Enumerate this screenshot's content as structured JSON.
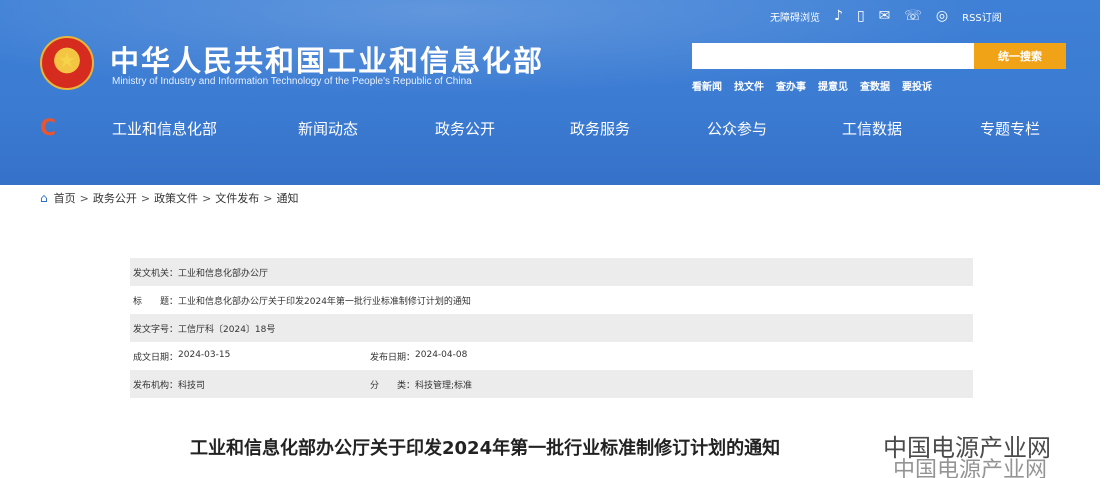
{
  "header": {
    "title": "中华人民共和国工业和信息化部",
    "subtitle": "Ministry of Industry and Information Technology of the People's Republic of China",
    "top_links": {
      "accessibility": "无障碍浏览",
      "rss": "RSS订阅"
    },
    "search": {
      "placeholder": "",
      "button_label": "统一搜索"
    },
    "quick_links": [
      "看新闻",
      "找文件",
      "查办事",
      "提意见",
      "查数据",
      "要投诉"
    ]
  },
  "nav": {
    "items": [
      "工业和信息化部",
      "新闻动态",
      "政务公开",
      "政务服务",
      "公众参与",
      "工信数据",
      "专题专栏"
    ]
  },
  "breadcrumb": [
    "首页",
    "政务公开",
    "政策文件",
    "文件发布",
    "通知"
  ],
  "meta": {
    "issuer_label": "发文机关：",
    "issuer": "工业和信息化部办公厅",
    "subject_label": "标　　题：",
    "subject": "工业和信息化部办公厅关于印发2024年第一批行业标准制修订计划的通知",
    "doc_no_label": "发文字号：",
    "doc_no": "工信厅科〔2024〕18号",
    "written_label": "成文日期：",
    "written": "2024-03-15",
    "published_label": "发布日期：",
    "published": "2024-04-08",
    "org_label": "发布机构：",
    "org": "科技司",
    "category_label": "分　　类：",
    "category": "科技管理;标准"
  },
  "document": {
    "title": "工业和信息化部办公厅关于印发2024年第一批行业标准制修订计划的通知"
  },
  "watermark": {
    "top": "中国电源产业网",
    "bottom": "中国电源产业网"
  }
}
